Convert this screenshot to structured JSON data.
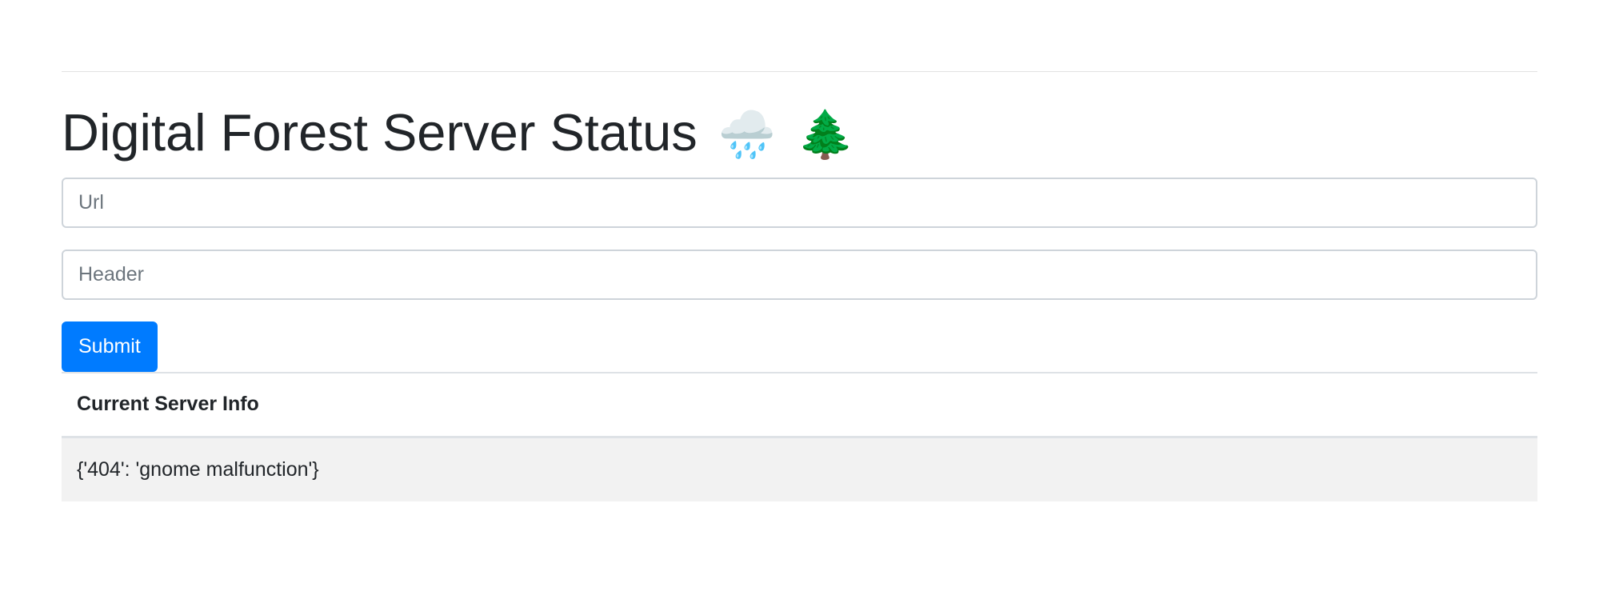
{
  "header": {
    "title": "Digital Forest Server Status",
    "title_emojis": [
      "🌧️",
      "🌲"
    ]
  },
  "form": {
    "url_placeholder": "Url",
    "url_value": "",
    "header_placeholder": "Header",
    "header_value": "",
    "submit_label": "Submit"
  },
  "info_table": {
    "column_header": "Current Server Info",
    "rows": [
      "{'404': 'gnome malfunction'}"
    ]
  },
  "colors": {
    "accent": "#007bff",
    "text": "#212529",
    "row_background": "#f2f2f2"
  }
}
